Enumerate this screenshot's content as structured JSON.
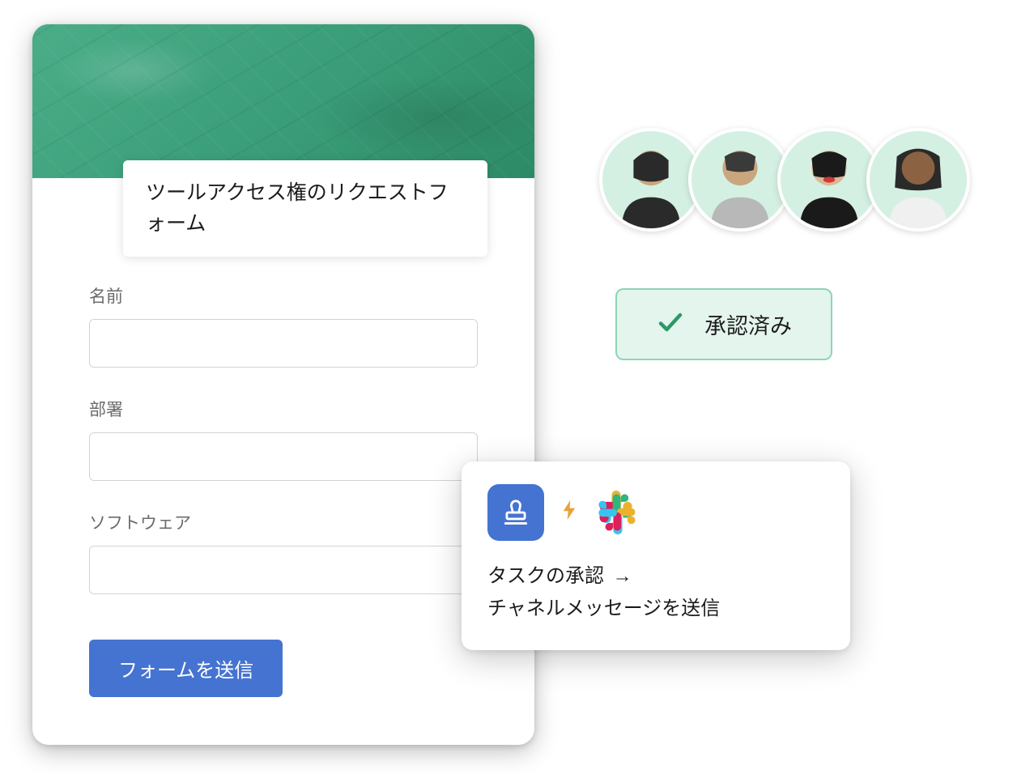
{
  "form": {
    "title": "ツールアクセス権のリクエストフォーム",
    "fields": {
      "name": {
        "label": "名前",
        "value": ""
      },
      "department": {
        "label": "部署",
        "value": ""
      },
      "software": {
        "label": "ソフトウェア",
        "value": ""
      }
    },
    "submit_label": "フォームを送信"
  },
  "approved": {
    "label": "承認済み"
  },
  "workflow": {
    "line1": "タスクの承認",
    "arrow": "→",
    "line2": "チャネルメッセージを送信"
  },
  "avatars": {
    "count": 4
  },
  "colors": {
    "primary_blue": "#4573d1",
    "header_green": "#3b9e7a",
    "approved_bg": "#e3f5ed",
    "approved_border": "#8fd4b8",
    "check_green": "#2d9968"
  }
}
